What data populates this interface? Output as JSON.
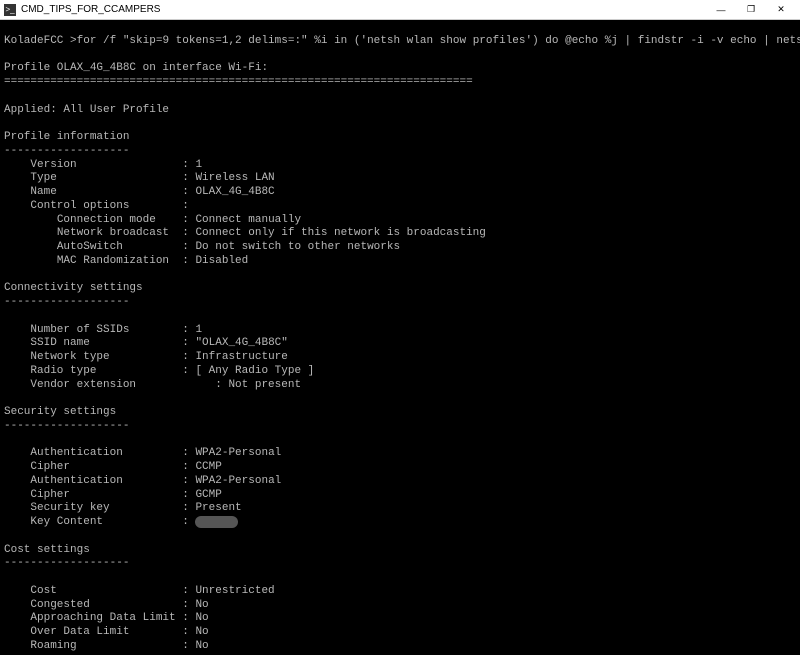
{
  "window": {
    "title": "CMD_TIPS_FOR_CCAMPERS",
    "icon_glyph": ">_"
  },
  "prompt": {
    "user": "KoladeFCC",
    "command": "for /f \"skip=9 tokens=1,2 delims=:\" %i in ('netsh wlan show profiles') do @echo %j | findstr -i -v echo | netsh wlan show profiles %j key=clear"
  },
  "header": "Profile OLAX_4G_4B8C on interface Wi-Fi:",
  "applied": "Applied: All User Profile",
  "sections": {
    "profile_info": {
      "title": "Profile information",
      "version": {
        "k": "Version",
        "v": "1"
      },
      "type": {
        "k": "Type",
        "v": "Wireless LAN"
      },
      "name": {
        "k": "Name",
        "v": "OLAX_4G_4B8C"
      },
      "control_options": "Control options",
      "conn_mode": {
        "k": "Connection mode",
        "v": "Connect manually"
      },
      "net_bcast": {
        "k": "Network broadcast",
        "v": "Connect only if this network is broadcasting"
      },
      "autoswitch": {
        "k": "AutoSwitch",
        "v": "Do not switch to other networks"
      },
      "mac_rand": {
        "k": "MAC Randomization",
        "v": "Disabled"
      }
    },
    "connectivity": {
      "title": "Connectivity settings",
      "num_ssids": {
        "k": "Number of SSIDs",
        "v": "1"
      },
      "ssid_name": {
        "k": "SSID name",
        "v": "\"OLAX_4G_4B8C\""
      },
      "net_type": {
        "k": "Network type",
        "v": "Infrastructure"
      },
      "radio": {
        "k": "Radio type",
        "v": "[ Any Radio Type ]"
      },
      "vendor": {
        "k": "Vendor extension",
        "v": ": Not present"
      }
    },
    "security": {
      "title": "Security settings",
      "auth1": {
        "k": "Authentication",
        "v": "WPA2-Personal"
      },
      "cipher1": {
        "k": "Cipher",
        "v": "CCMP"
      },
      "auth2": {
        "k": "Authentication",
        "v": "WPA2-Personal"
      },
      "cipher2": {
        "k": "Cipher",
        "v": "GCMP"
      },
      "sec_key": {
        "k": "Security key",
        "v": "Present"
      },
      "key_content": {
        "k": "Key Content",
        "v": ""
      }
    },
    "cost": {
      "title": "Cost settings",
      "cost": {
        "k": "Cost",
        "v": "Unrestricted"
      },
      "congested": {
        "k": "Congested",
        "v": "No"
      },
      "appr_lim": {
        "k": "Approaching Data Limit",
        "v": "No"
      },
      "over_lim": {
        "k": "Over Data Limit",
        "v": "No"
      },
      "roaming": {
        "k": "Roaming",
        "v": "No"
      }
    }
  },
  "dash": {
    "long": "=======================================================================",
    "short": "-------------------"
  }
}
